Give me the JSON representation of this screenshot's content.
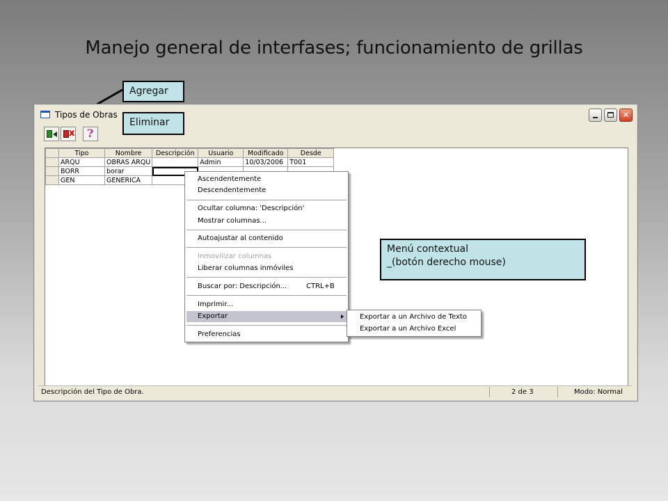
{
  "slide": {
    "title": "Manejo general de interfases; funcionamiento de grillas"
  },
  "callouts": {
    "agregar": "Agregar",
    "eliminar": "Eliminar",
    "menu_line1": "Menú contextual",
    "menu_line2": "_(botón derecho mouse)"
  },
  "window": {
    "title": "Tipos de Obras",
    "controls": {
      "minimize": "_",
      "close": "✕"
    }
  },
  "toolbar": {
    "buttons": [
      {
        "name": "add-button",
        "icon": "add-record-icon"
      },
      {
        "name": "delete-button",
        "icon": "delete-record-icon"
      },
      {
        "name": "help-button",
        "icon": "help-icon",
        "glyph": "?"
      }
    ]
  },
  "grid": {
    "columns": [
      "Tipo",
      "Nombre",
      "Descripción",
      "Usuario",
      "Modificado",
      "Desde"
    ],
    "rows": [
      [
        "ARQU",
        "OBRAS ARQU",
        "",
        "Admin",
        "10/03/2006",
        "T001"
      ],
      [
        "BORR",
        "borar",
        "",
        "",
        "",
        ""
      ],
      [
        "GEN",
        "GENERICA",
        "",
        "",
        "",
        ""
      ]
    ]
  },
  "statusbar": {
    "description": "Descripción del Tipo de Obra.",
    "record": "2 de 3",
    "mode": "Modo: Normal"
  },
  "context_menu": {
    "items": [
      {
        "label": "Ascendentemente"
      },
      {
        "label": "Descendentemente"
      },
      {
        "label": "Ocultar columna: 'Descripción'"
      },
      {
        "label": "Mostrar columnas..."
      },
      {
        "label": "Autoajustar al contenido"
      },
      {
        "label": "Inmovilizar columnas",
        "disabled": true
      },
      {
        "label": "Liberar columnas inmóviles"
      },
      {
        "label": "Buscar por: Descripción...",
        "shortcut": "CTRL+B"
      },
      {
        "label": "Imprimir..."
      },
      {
        "label": "Exportar",
        "submenu": true,
        "highlighted": true
      },
      {
        "label": "Preferencias"
      }
    ]
  },
  "submenu": {
    "items": [
      {
        "label": "Exportar a un Archivo de Texto"
      },
      {
        "label": "Exportar a un Archivo Excel"
      }
    ]
  }
}
